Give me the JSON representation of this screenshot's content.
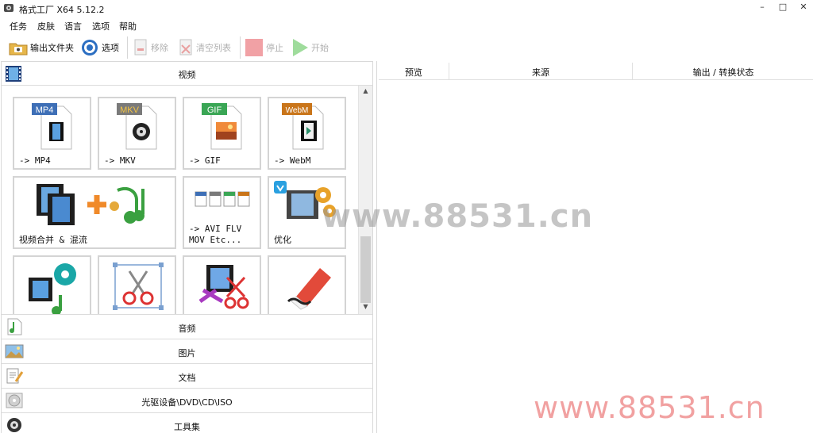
{
  "window": {
    "title": "格式工厂 X64 5.12.2",
    "minimize_glyph": "–",
    "maximize_glyph": "□",
    "close_glyph": "✕"
  },
  "menu": [
    "任务",
    "皮肤",
    "语言",
    "选项",
    "帮助"
  ],
  "toolbar": {
    "output_folder": "输出文件夹",
    "options": "选项",
    "remove": "移除",
    "clear_list": "清空列表",
    "stop": "停止",
    "start": "开始"
  },
  "left_panel": {
    "video_category": "视频",
    "tiles": [
      {
        "label": "-> MP4",
        "badge": "MP4",
        "badge_color": "#3e6fb6",
        "icon": "mp4-file-icon"
      },
      {
        "label": "-> MKV",
        "badge": "MKV",
        "badge_color": "#7a7a7a",
        "icon": "mkv-file-icon"
      },
      {
        "label": "-> GIF",
        "badge": "GIF",
        "badge_color": "#3aa655",
        "icon": "gif-file-icon"
      },
      {
        "label": "-> WebM",
        "badge": "WebM",
        "badge_color": "#c9751a",
        "icon": "webm-file-icon"
      },
      {
        "label": "视频合并 & 混流",
        "icon": "video-merge-mux-icon"
      },
      {
        "label": "-> AVI FLV\nMOV Etc...",
        "icon": "other-formats-icon"
      },
      {
        "label": "优化",
        "icon": "optimize-icon"
      },
      {
        "label": "",
        "icon": "separate-audio-icon"
      },
      {
        "label": "",
        "icon": "crop-icon"
      },
      {
        "label": "",
        "icon": "quick-clip-icon"
      },
      {
        "label": "",
        "icon": "remove-logo-icon"
      }
    ],
    "bottom_categories": [
      {
        "label": "音频",
        "icon": "audio-category-icon"
      },
      {
        "label": "图片",
        "icon": "picture-category-icon"
      },
      {
        "label": "文档",
        "icon": "document-category-icon"
      },
      {
        "label": "光驱设备\\DVD\\CD\\ISO",
        "icon": "disc-category-icon"
      },
      {
        "label": "工具集",
        "icon": "toolbox-category-icon"
      }
    ]
  },
  "task_list": {
    "columns": [
      "预览",
      "来源",
      "输出 / 转换状态"
    ]
  },
  "watermarks": {
    "center": "www.88531.cn",
    "bottom_right": "www.88531.cn"
  }
}
